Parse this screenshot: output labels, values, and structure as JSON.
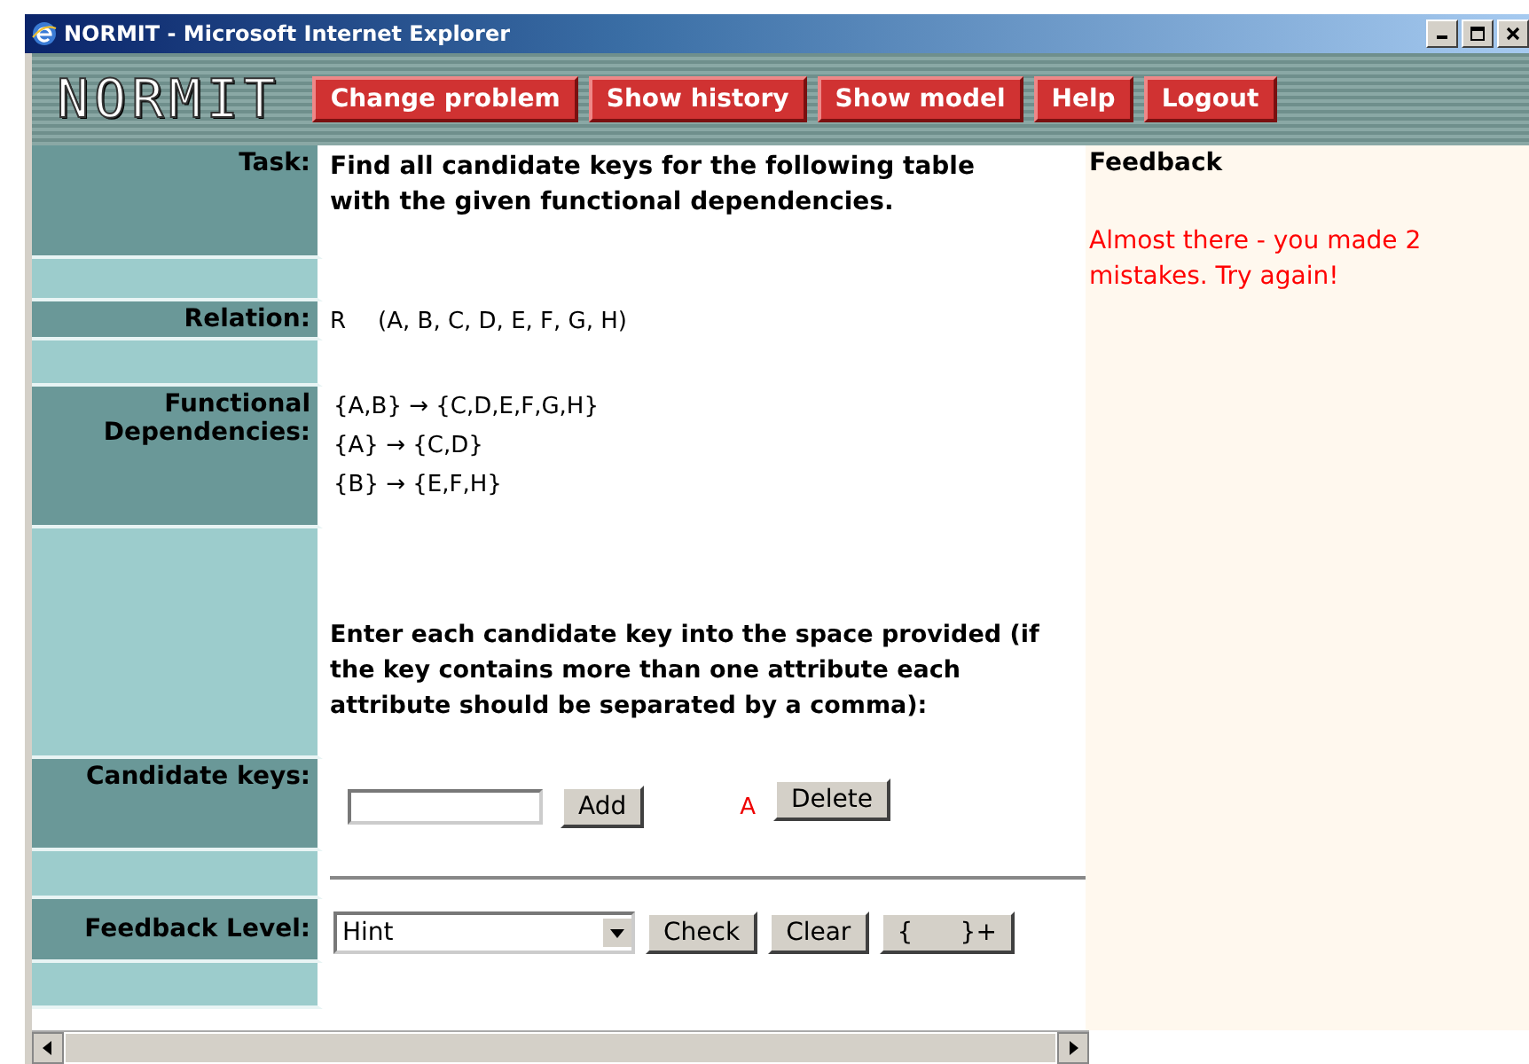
{
  "window": {
    "title": "NORMIT - Microsoft Internet Explorer"
  },
  "header": {
    "logo": "NORMIT",
    "buttons": [
      "Change problem",
      "Show history",
      "Show model",
      "Help",
      "Logout"
    ]
  },
  "task": {
    "label": "Task:",
    "text": "Find all candidate keys for the following table with the given functional dependencies."
  },
  "relation": {
    "label": "Relation:",
    "name": "R",
    "attributes": "(A, B, C, D, E, F, G, H)"
  },
  "dependencies": {
    "label": "Functional Dependencies:",
    "items": [
      {
        "left": "{A,B}",
        "arrow": "→",
        "right": "{C,D,E,F,G,H}"
      },
      {
        "left": "{A}",
        "arrow": "→",
        "right": "{C,D}"
      },
      {
        "left": "{B}",
        "arrow": "→",
        "right": "{E,F,H}"
      }
    ]
  },
  "instruction": "Enter each candidate key into the space provided (if the key contains more than one attribute each attribute should be separated by a comma):",
  "candidate_keys": {
    "label": "Candidate keys:",
    "add_button": "Add",
    "keys": [
      {
        "text": "A",
        "delete_button": "Delete"
      }
    ]
  },
  "feedback_level": {
    "label": "Feedback Level:",
    "value": "Hint",
    "buttons": [
      "Check",
      "Clear",
      "{      }+"
    ]
  },
  "feedback": {
    "heading": "Feedback",
    "message": "Almost there - you made 2 mistakes. Try again!"
  }
}
